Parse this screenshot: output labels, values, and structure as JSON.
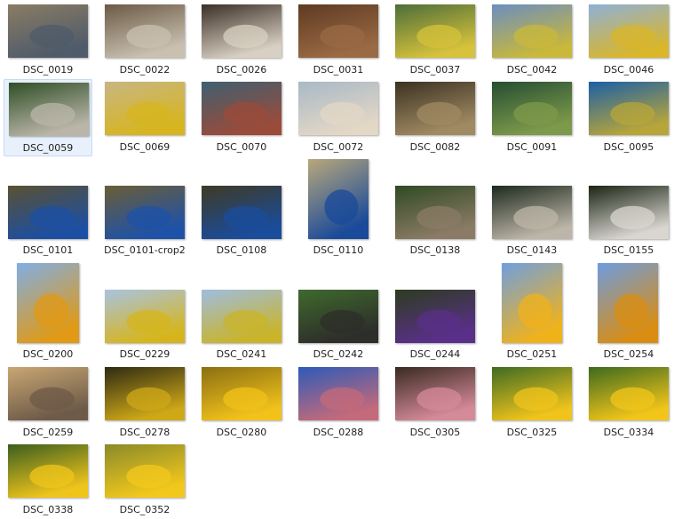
{
  "files": [
    {
      "name": "DSC_0019",
      "c1": "#8a7c63",
      "c2": "#4f5b6a",
      "sel": false
    },
    {
      "name": "DSC_0022",
      "c1": "#6b5a45",
      "c2": "#c9c0b0",
      "sel": false
    },
    {
      "name": "DSC_0026",
      "c1": "#3b2f26",
      "c2": "#d8d0c2",
      "sel": false
    },
    {
      "name": "DSC_0031",
      "c1": "#5e3a22",
      "c2": "#9a6a44",
      "sel": false
    },
    {
      "name": "DSC_0037",
      "c1": "#4d6e3a",
      "c2": "#d6c23b",
      "sel": false
    },
    {
      "name": "DSC_0042",
      "c1": "#6b8ec0",
      "c2": "#c9b83a",
      "sel": false
    },
    {
      "name": "DSC_0046",
      "c1": "#8fb0d8",
      "c2": "#d9b62a",
      "sel": false
    },
    {
      "name": "DSC_0059",
      "c1": "#2f4f26",
      "c2": "#b9b5a8",
      "sel": true
    },
    {
      "name": "DSC_0069",
      "c1": "#c7b683",
      "c2": "#d7b51f",
      "sel": false
    },
    {
      "name": "DSC_0070",
      "c1": "#3f5f70",
      "c2": "#9a4b3a",
      "sel": false
    },
    {
      "name": "DSC_0072",
      "c1": "#a8b9c6",
      "c2": "#e3d7c6",
      "sel": false
    },
    {
      "name": "DSC_0082",
      "c1": "#3c3222",
      "c2": "#a08a62",
      "sel": false
    },
    {
      "name": "DSC_0091",
      "c1": "#264e33",
      "c2": "#7d9a4a",
      "sel": false
    },
    {
      "name": "DSC_0095",
      "c1": "#1c5fa6",
      "c2": "#b7a53a",
      "sel": false
    },
    {
      "name": "DSC_0101",
      "c1": "#5a5132",
      "c2": "#1c4fa3",
      "sel": false
    },
    {
      "name": "DSC_0101-crop2",
      "c1": "#6b5d36",
      "c2": "#1e52a8",
      "sel": false
    },
    {
      "name": "DSC_0108",
      "c1": "#3f3a23",
      "c2": "#1a4c9c",
      "sel": false
    },
    {
      "name": "DSC_0110",
      "c1": "#b9a87a",
      "c2": "#1a4a9a",
      "sel": false
    },
    {
      "name": "DSC_0138",
      "c1": "#2f4a23",
      "c2": "#8b7b66",
      "sel": false
    },
    {
      "name": "DSC_0143",
      "c1": "#1d2a1e",
      "c2": "#bdb6a8",
      "sel": false
    },
    {
      "name": "DSC_0155",
      "c1": "#1b2515",
      "c2": "#d9d6d0",
      "sel": false
    },
    {
      "name": "DSC_0200",
      "c1": "#7faee6",
      "c2": "#e09a16",
      "sel": false
    },
    {
      "name": "DSC_0229",
      "c1": "#a9c3e2",
      "c2": "#d6b51c",
      "sel": false
    },
    {
      "name": "DSC_0241",
      "c1": "#9fbde0",
      "c2": "#c9b42a",
      "sel": false
    },
    {
      "name": "DSC_0242",
      "c1": "#3e6a2c",
      "c2": "#2d2d2a",
      "sel": false
    },
    {
      "name": "DSC_0244",
      "c1": "#2c3c1f",
      "c2": "#5a2f8a",
      "sel": false
    },
    {
      "name": "DSC_0251",
      "c1": "#6f9fe0",
      "c2": "#f0b21b",
      "sel": false
    },
    {
      "name": "DSC_0254",
      "c1": "#6d9ce0",
      "c2": "#d98d12",
      "sel": false
    },
    {
      "name": "DSC_0259",
      "c1": "#c9a773",
      "c2": "#6d5a48",
      "sel": false
    },
    {
      "name": "DSC_0278",
      "c1": "#2e2a12",
      "c2": "#cfa818",
      "sel": false
    },
    {
      "name": "DSC_0280",
      "c1": "#8a6f12",
      "c2": "#f2c21a",
      "sel": false
    },
    {
      "name": "DSC_0288",
      "c1": "#2d5ab8",
      "c2": "#c46a7a",
      "sel": false
    },
    {
      "name": "DSC_0305",
      "c1": "#3a2a20",
      "c2": "#d58a9a",
      "sel": false
    },
    {
      "name": "DSC_0325",
      "c1": "#3f6b22",
      "c2": "#f0c41c",
      "sel": false
    },
    {
      "name": "DSC_0334",
      "c1": "#3e6a1e",
      "c2": "#f2c51a",
      "sel": false
    },
    {
      "name": "DSC_0338",
      "c1": "#3b5e1f",
      "c2": "#f0c51b",
      "sel": false
    },
    {
      "name": "DSC_0352",
      "c1": "#8a8a2a",
      "c2": "#f3c81c",
      "sel": false
    }
  ]
}
